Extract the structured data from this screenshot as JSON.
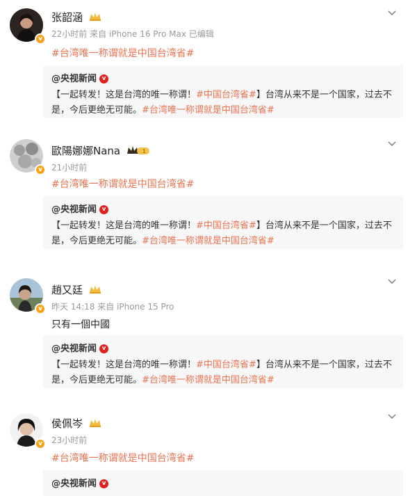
{
  "colors": {
    "hashtag": "#eb7350",
    "vbadge": "#f7a21b",
    "cctv_badge": "#e2211c"
  },
  "posts": [
    {
      "name": "张韶涵",
      "meta": "22小时前  来自 iPhone 16 Pro Max 已编辑",
      "text": "#台湾唯一称谓就是中国台湾省#",
      "repost": {
        "author": "@央视新闻",
        "text_a": "【一起转发！这是台湾的唯一称谓！",
        "tag_a": "#中国台湾省#",
        "text_b": "】台湾从来不是一个国家，过去不是，今后更绝无可能。",
        "tag_b": "#台湾唯一称谓就是中国台湾省#"
      }
    },
    {
      "name": "歐陽娜娜Nana",
      "meta": "21小时前",
      "text": "#台湾唯一称谓就是中国台湾省#",
      "repost": {
        "author": "@央视新闻",
        "text_a": "【一起转发！这是台湾的唯一称谓！",
        "tag_a": "#中国台湾省#",
        "text_b": "】台湾从来不是一个国家，过去不是，今后更绝无可能。",
        "tag_b": "#台湾唯一称谓就是中国台湾省#"
      }
    },
    {
      "name": "趙又廷",
      "meta": "昨天 14:18  来自 iPhone 15 Pro",
      "text": "只有一個中國",
      "repost": {
        "author": "@央视新闻",
        "text_a": "【一起转发！这是台湾的唯一称谓！",
        "tag_a": "#中国台湾省#",
        "text_b": "】台湾从来不是一个国家，过去不是，今后更绝无可能。",
        "tag_b": "#台湾唯一称谓就是中国台湾省#"
      }
    },
    {
      "name": "侯佩岑",
      "meta": "23小时前",
      "text": "#台湾唯一称谓就是中国台湾省#",
      "repost": {
        "author": "@央视新闻"
      }
    }
  ],
  "icons": {
    "chevron": "chevron-down-icon",
    "vip": "crown-icon",
    "verified": "verified-badge-icon"
  }
}
